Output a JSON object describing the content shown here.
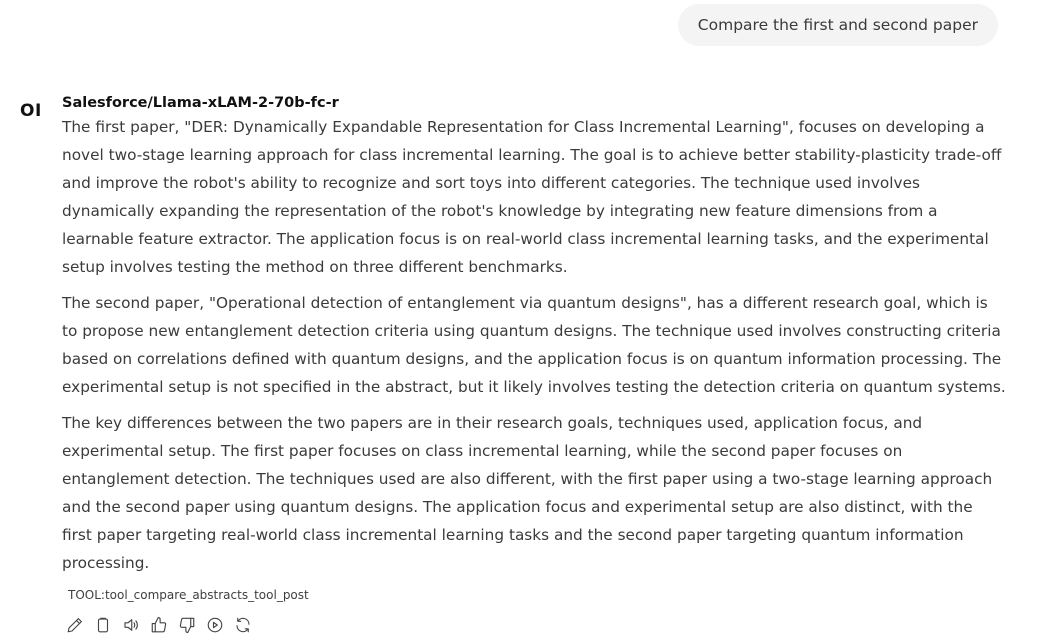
{
  "user_message": {
    "text": "Compare the first and second paper"
  },
  "assistant": {
    "avatar_text": "OI",
    "model_name": "Salesforce/Llama-xLAM-2-70b-fc-r",
    "paragraphs": [
      "The first paper, \"DER: Dynamically Expandable Representation for Class Incremental Learning\", focuses on developing a novel two-stage learning approach for class incremental learning. The goal is to achieve better stability-plasticity trade-off and improve the robot's ability to recognize and sort toys into different categories. The technique used involves dynamically expanding the representation of the robot's knowledge by integrating new feature dimensions from a learnable feature extractor. The application focus is on real-world class incremental learning tasks, and the experimental setup involves testing the method on three different benchmarks.",
      "The second paper, \"Operational detection of entanglement via quantum designs\", has a different research goal, which is to propose new entanglement detection criteria using quantum designs. The technique used involves constructing criteria based on correlations defined with quantum designs, and the application focus is on quantum information processing. The experimental setup is not specified in the abstract, but it likely involves testing the detection criteria on quantum systems.",
      "The key differences between the two papers are in their research goals, techniques used, application focus, and experimental setup. The first paper focuses on class incremental learning, while the second paper focuses on entanglement detection. The techniques used are also different, with the first paper using a two-stage learning approach and the second paper using quantum designs. The application focus and experimental setup are also distinct, with the first paper targeting real-world class incremental learning tasks and the second paper targeting quantum information processing."
    ],
    "tool_label": "TOOL:tool_compare_abstracts_tool_post"
  },
  "actions": [
    {
      "icon": "pencil-icon",
      "name": "edit-button"
    },
    {
      "icon": "clipboard-icon",
      "name": "copy-button"
    },
    {
      "icon": "speaker-icon",
      "name": "read-aloud-button"
    },
    {
      "icon": "thumbs-up-icon",
      "name": "good-response-button"
    },
    {
      "icon": "thumbs-down-icon",
      "name": "bad-response-button"
    },
    {
      "icon": "play-circle-icon",
      "name": "continue-button"
    },
    {
      "icon": "refresh-icon",
      "name": "regenerate-button"
    }
  ]
}
